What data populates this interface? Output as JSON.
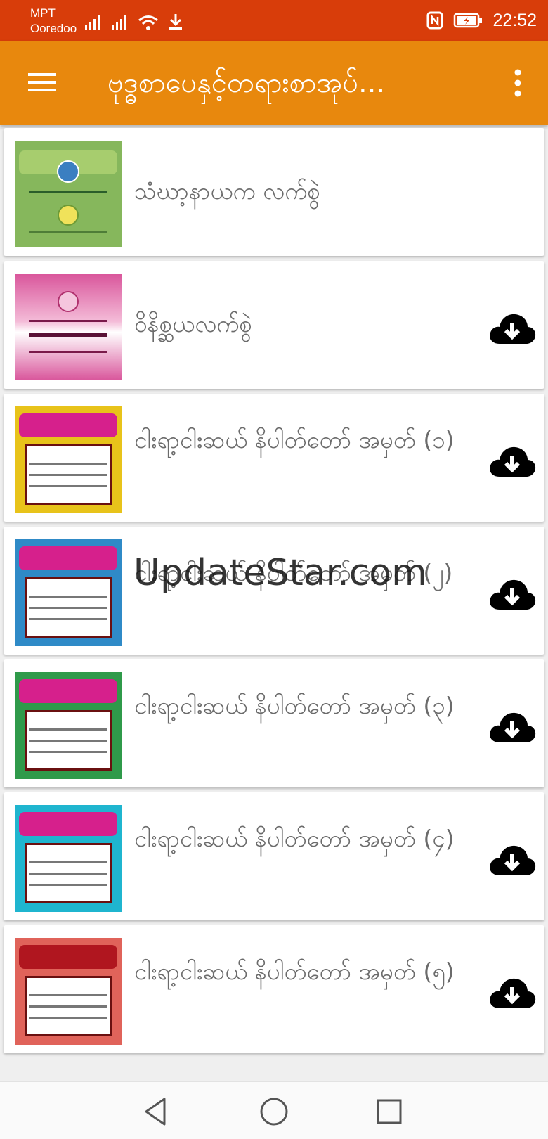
{
  "status_bar": {
    "carrier_line1": "MPT",
    "carrier_line2": "Ooredoo",
    "time": "22:52"
  },
  "app_bar": {
    "title": "ဗုဒ္ဓစာပေနှင့်တရားစာအုပ်..."
  },
  "items": [
    {
      "title": "သံဃာ့နာယက လက်စွဲ",
      "cover_color": "#86b75c",
      "downloadable": false
    },
    {
      "title": "ဝိနိစ္ဆယလက်စွဲ",
      "cover_color": "#d9559b",
      "downloadable": true
    },
    {
      "title": "ငါးရာ့ငါးဆယ် နိပါတ်တော် အမှတ် (၁)",
      "cover_color": "#e8c31a",
      "downloadable": true
    },
    {
      "title": "ငါးရာ့ငါးဆယ် နိပါတ်တော် အမှတ် (၂)",
      "cover_color": "#2f8ac7",
      "downloadable": true
    },
    {
      "title": "ငါးရာ့ငါးဆယ် နိပါတ်တော် အမှတ် (၃)",
      "cover_color": "#2f9a4a",
      "downloadable": true
    },
    {
      "title": "ငါးရာ့ငါးဆယ် နိပါတ်တော် အမှတ် (၄)",
      "cover_color": "#1fb5cf",
      "downloadable": true
    },
    {
      "title": "ငါးရာ့ငါးဆယ် နိပါတ်တော် အမှတ် (၅)",
      "cover_color": "#e0635a",
      "downloadable": true
    }
  ],
  "watermark": "UpdateStar.com",
  "icons": {
    "menu": "hamburger-menu-icon",
    "more": "more-vert-icon",
    "download": "cloud-download-icon",
    "back": "back-triangle-icon",
    "home": "home-circle-icon",
    "recents": "recents-square-icon"
  }
}
